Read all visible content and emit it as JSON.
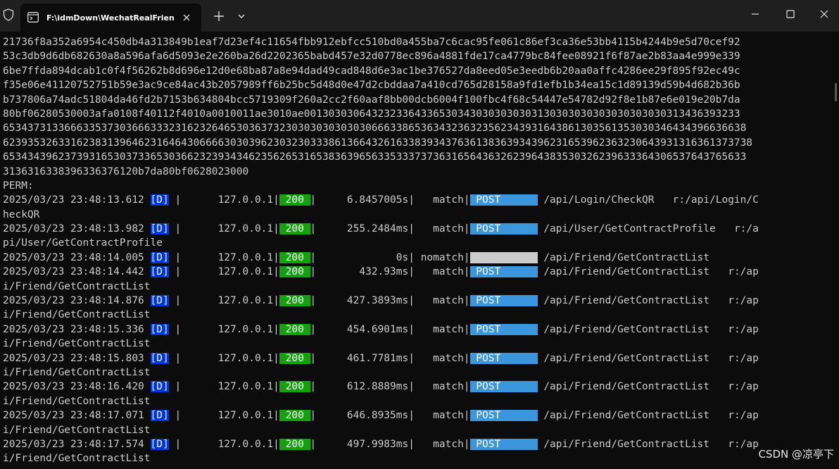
{
  "window": {
    "tab_title": "F:\\idmDown\\WechatRealFrien",
    "new_tab_symbol": "+",
    "icons": [
      "shield-icon",
      "terminal-icon",
      "close-icon",
      "plus-icon",
      "chevron-down-icon",
      "minimize-icon",
      "maximize-icon",
      "close-window-icon"
    ]
  },
  "terminal": {
    "colors": {
      "background": "#0c0c0c",
      "text": "#cccccc",
      "debug_badge": "#0037da",
      "status_200": "#13a10e",
      "post_method": "#3a96dd"
    },
    "hex_lines": [
      "21736f8a352a6954c450db4a313849b1eaf7d23ef4c11654fbb912ebfcc510bd0a455ba7c6cac95fe061c86ef3ca36e53bb4115b4244b9e5d70cef92",
      "53c3db9d6db682630a8a596afa6d5093e2e260ba26d2202365babd457e32d0778ec896a4881fde17ca4779bc84fee08921f6f87ae2b83aa4e999e339",
      "6be7ffda894dcab1c0f4f56262b8d696e12d0e68ba87a8e94dad49cad848d6e3ac1be376527da8eed05e3eedb6b20aa0affc4286ee29f895f92ec49c",
      "f35e06e41120752751b59e3ac9ce84ac43b2057989ff6b25bc5d48d0e47d2cbddaa7a410cd765d28158a9fd1efb1b34ea15c1d89139d59b4d682b36b",
      "b737806a74adc51804da46fd2b7153b634804bcc5719309f260a2cc2f60aaf8bb00dcb6004f100fbc4f68c54447e54782d92f8e1b87e6e019e20b7da",
      "80bf06280530003afa0108f40112f4010a0010011ae3010ae00130303064323233643365303430303030303130303030303030303030313436393233",
      "6534373133666335373036663332316232646530363732303030303030306663386536343236323562343931643861303561353030346434396636638",
      "62393532633162383139646231646430666630303962303230333861366432616338393437636138363934396231653962363230643931316361373738",
      "6534343962373931653037336530366232393434623562653165383639656335333737363165643632623964383530326239633364306537643765633",
      "3136316338396336376120b7da80bf0628023000"
    ],
    "perm_label": "PERM:",
    "log_entries": [
      {
        "time": "2025/03/23 23:48:13.612",
        "level": "[D]",
        "ip": "127.0.0.1",
        "status": "200",
        "latency": "6.8457005s",
        "match": "match",
        "method": "POST",
        "path": "/api/Login/CheckQR",
        "tail": "r:/api/Login/C",
        "cont": "heckQR"
      },
      {
        "time": "2025/03/23 23:48:13.982",
        "level": "[D]",
        "ip": "127.0.0.1",
        "status": "200",
        "latency": "255.2484ms",
        "match": "match",
        "method": "POST",
        "path": "/api/User/GetContractProfile",
        "tail": "r:/a",
        "cont": "pi/User/GetContractProfile"
      },
      {
        "time": "2025/03/23 23:48:14.005",
        "level": "[D]",
        "ip": "127.0.0.1",
        "status": "200",
        "latency": "0s",
        "match": "nomatch",
        "method": "",
        "path": "/api/Friend/GetContractList",
        "tail": "",
        "cont": ""
      },
      {
        "time": "2025/03/23 23:48:14.442",
        "level": "[D]",
        "ip": "127.0.0.1",
        "status": "200",
        "latency": "432.93ms",
        "match": "match",
        "method": "POST",
        "path": "/api/Friend/GetContractList",
        "tail": "r:/ap",
        "cont": "i/Friend/GetContractList"
      },
      {
        "time": "2025/03/23 23:48:14.876",
        "level": "[D]",
        "ip": "127.0.0.1",
        "status": "200",
        "latency": "427.3893ms",
        "match": "match",
        "method": "POST",
        "path": "/api/Friend/GetContractList",
        "tail": "r:/ap",
        "cont": "i/Friend/GetContractList"
      },
      {
        "time": "2025/03/23 23:48:15.336",
        "level": "[D]",
        "ip": "127.0.0.1",
        "status": "200",
        "latency": "454.6901ms",
        "match": "match",
        "method": "POST",
        "path": "/api/Friend/GetContractList",
        "tail": "r:/ap",
        "cont": "i/Friend/GetContractList"
      },
      {
        "time": "2025/03/23 23:48:15.803",
        "level": "[D]",
        "ip": "127.0.0.1",
        "status": "200",
        "latency": "461.7781ms",
        "match": "match",
        "method": "POST",
        "path": "/api/Friend/GetContractList",
        "tail": "r:/ap",
        "cont": "i/Friend/GetContractList"
      },
      {
        "time": "2025/03/23 23:48:16.420",
        "level": "[D]",
        "ip": "127.0.0.1",
        "status": "200",
        "latency": "612.8889ms",
        "match": "match",
        "method": "POST",
        "path": "/api/Friend/GetContractList",
        "tail": "r:/ap",
        "cont": "i/Friend/GetContractList"
      },
      {
        "time": "2025/03/23 23:48:17.071",
        "level": "[D]",
        "ip": "127.0.0.1",
        "status": "200",
        "latency": "646.8935ms",
        "match": "match",
        "method": "POST",
        "path": "/api/Friend/GetContractList",
        "tail": "r:/ap",
        "cont": "i/Friend/GetContractList"
      },
      {
        "time": "2025/03/23 23:48:17.574",
        "level": "[D]",
        "ip": "127.0.0.1",
        "status": "200",
        "latency": "497.9983ms",
        "match": "match",
        "method": "POST",
        "path": "/api/Friend/GetContractList",
        "tail": "r:/ap",
        "cont": "i/Friend/GetContractList"
      }
    ]
  },
  "watermark": "CSDN @凉亭下"
}
